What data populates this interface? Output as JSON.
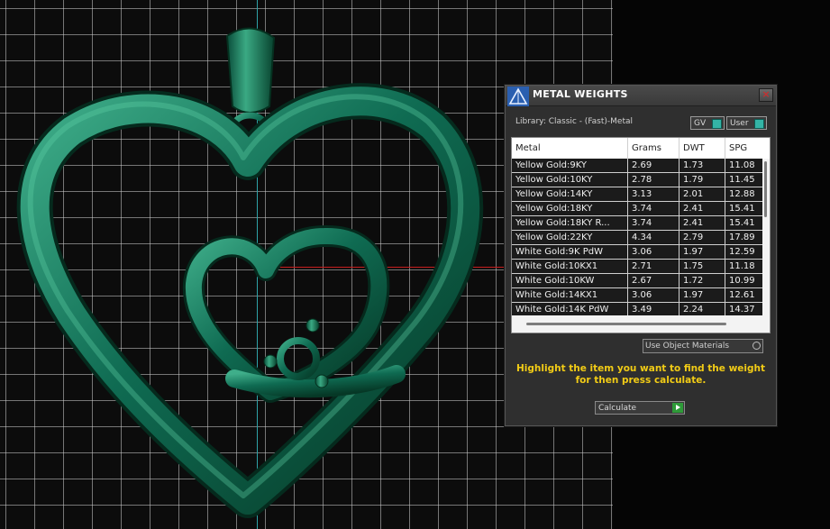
{
  "dialog": {
    "title": "METAL WEIGHTS",
    "close_label": "×",
    "library_label": "Library: Classic - (Fast)-Metal",
    "toggles": {
      "gv": "GV",
      "user": "User"
    },
    "table": {
      "columns": [
        "Metal",
        "Grams",
        "DWT",
        "SPG"
      ],
      "rows": [
        [
          "Yellow Gold:9KY",
          "2.69",
          "1.73",
          "11.08"
        ],
        [
          "Yellow Gold:10KY",
          "2.78",
          "1.79",
          "11.45"
        ],
        [
          "Yellow Gold:14KY",
          "3.13",
          "2.01",
          "12.88"
        ],
        [
          "Yellow Gold:18KY",
          "3.74",
          "2.41",
          "15.41"
        ],
        [
          "Yellow Gold:18KY R...",
          "3.74",
          "2.41",
          "15.41"
        ],
        [
          "Yellow Gold:22KY",
          "4.34",
          "2.79",
          "17.89"
        ],
        [
          "White Gold:9K PdW",
          "3.06",
          "1.97",
          "12.59"
        ],
        [
          "White Gold:10KX1",
          "2.71",
          "1.75",
          "11.18"
        ],
        [
          "White Gold:10KW",
          "2.67",
          "1.72",
          "10.99"
        ],
        [
          "White Gold:14KX1",
          "3.06",
          "1.97",
          "12.61"
        ],
        [
          "White Gold:14K PdW",
          "3.49",
          "2.24",
          "14.37"
        ]
      ]
    },
    "use_object_materials_label": "Use Object Materials",
    "instruction": "Highlight the item you want to find the weight for then press calculate.",
    "calculate_label": "Calculate"
  },
  "colors": {
    "viewport_bg": "#0c0c0c",
    "grid": "#cdcdcd",
    "pendant": "#0f6b52",
    "instruction_text": "#f2cc16",
    "row_bg": "#1b1b1b"
  },
  "icons": {
    "app": "pyramid-logo-icon",
    "close": "close-icon",
    "calculate": "play-arrow-icon"
  }
}
